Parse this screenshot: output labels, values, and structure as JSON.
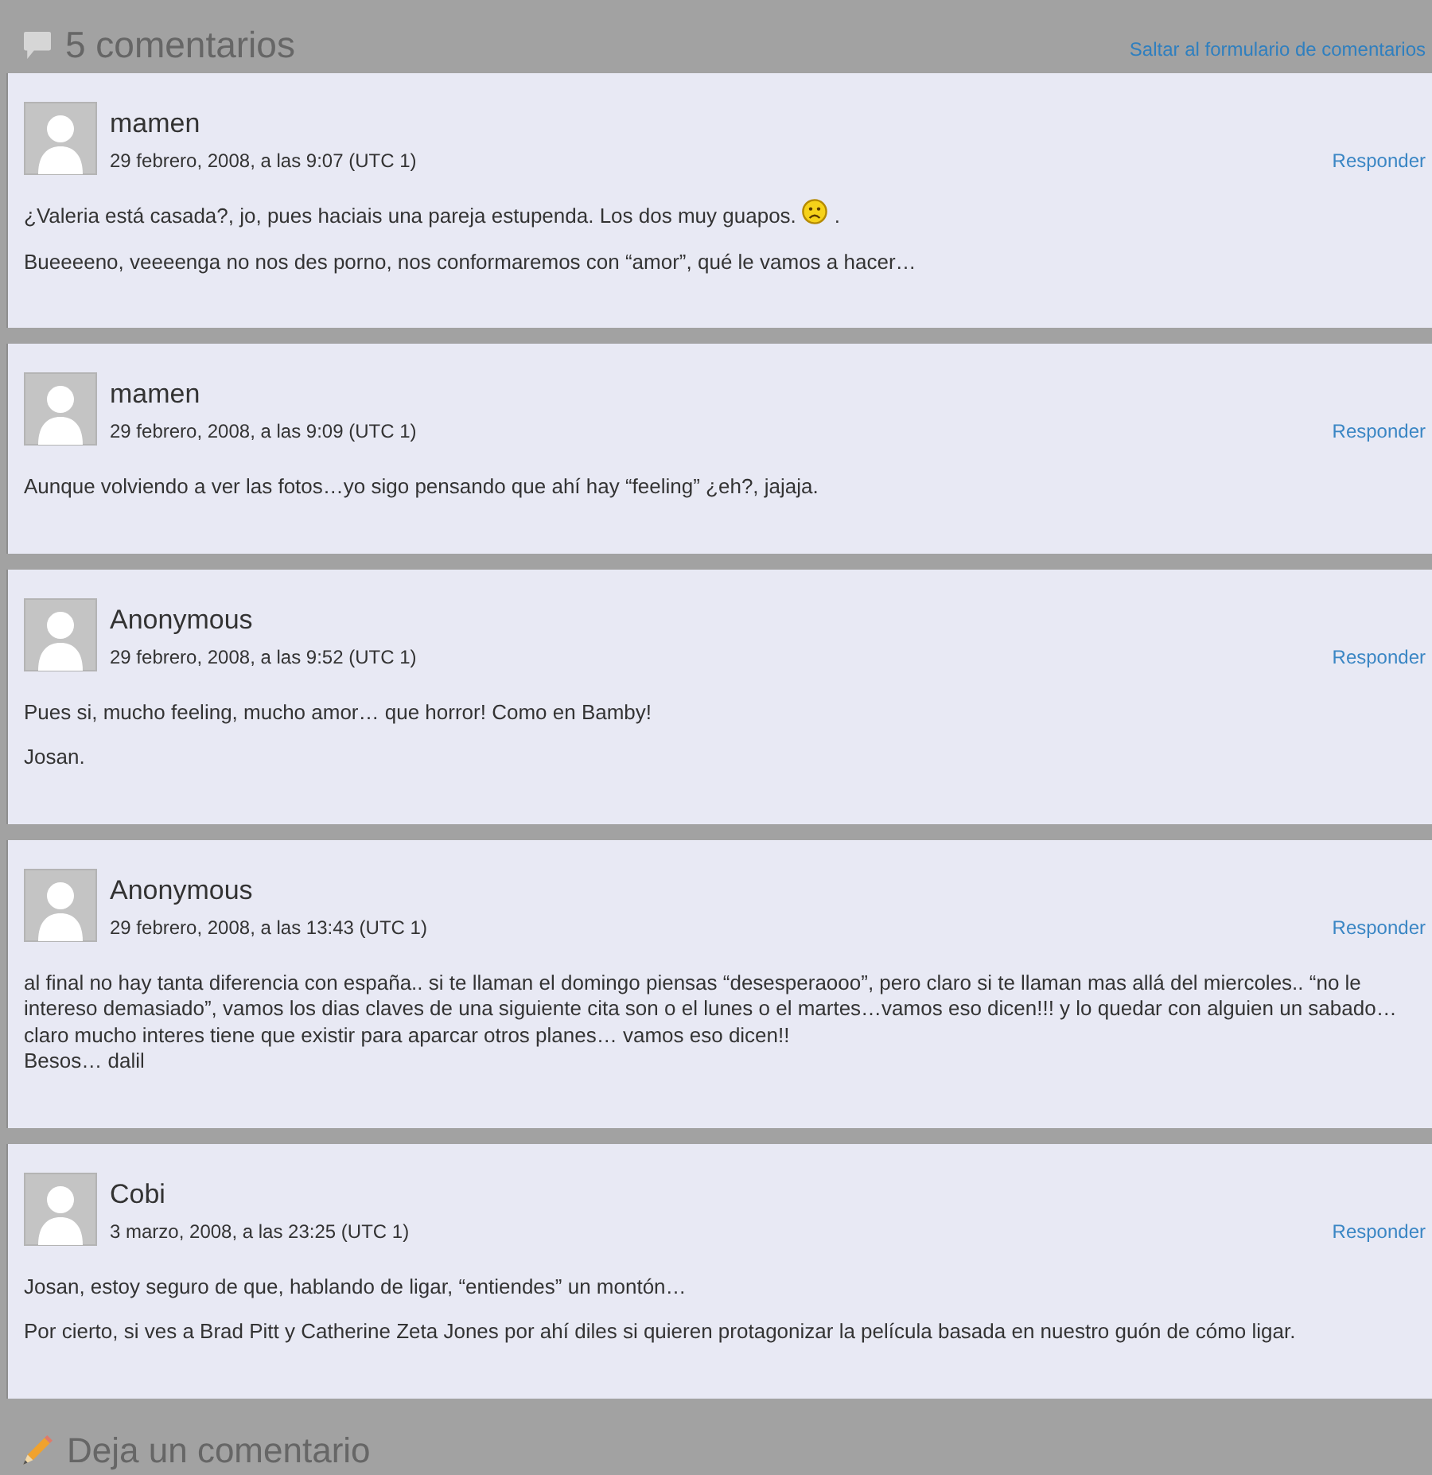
{
  "header": {
    "title": "5 comentarios",
    "skip_link": "Saltar al formulario de comentarios"
  },
  "comments": [
    {
      "author": "mamen",
      "date": "29 febrero, 2008, a las 9:07 (UTC 1)",
      "reply": "Responder",
      "paragraphs": [
        {
          "text": "¿Valeria está casada?, jo, pues haciais una pareja estupenda. Los dos muy guapos.",
          "emoticon": true,
          "tail": "."
        },
        {
          "text": "Bueeeeno, veeeenga no nos des porno, nos conformaremos con “amor”, qué le vamos a hacer…"
        }
      ]
    },
    {
      "author": "mamen",
      "date": "29 febrero, 2008, a las 9:09 (UTC 1)",
      "reply": "Responder",
      "paragraphs": [
        {
          "text": "Aunque volviendo a ver las fotos…yo sigo pensando que ahí hay “feeling” ¿eh?, jajaja."
        }
      ]
    },
    {
      "author": "Anonymous",
      "date": "29 febrero, 2008, a las 9:52 (UTC 1)",
      "reply": "Responder",
      "paragraphs": [
        {
          "text": "Pues si, mucho feeling, mucho amor… que horror! Como en Bamby!"
        },
        {
          "text": "Josan."
        }
      ]
    },
    {
      "author": "Anonymous",
      "date": "29 febrero, 2008, a las 13:43 (UTC 1)",
      "reply": "Responder",
      "paragraphs": [
        {
          "text": "al final no hay tanta diferencia con españa.. si te llaman el domingo piensas “desesperaooo”, pero claro si te llaman mas allá del miercoles.. “no le intereso demasiado”, vamos los dias claves de una siguiente cita son o el lunes o el martes…vamos eso dicen!!! y lo quedar con alguien un sabado… claro mucho interes tiene que existir para aparcar otros planes… vamos eso dicen!!\nBesos… dalil"
        }
      ]
    },
    {
      "author": "Cobi",
      "date": "3 marzo, 2008, a las 23:25 (UTC 1)",
      "reply": "Responder",
      "paragraphs": [
        {
          "text": "Josan, estoy seguro de que, hablando de ligar, “entiendes” un montón…"
        },
        {
          "text": "Por cierto, si ves a Brad Pitt y Catherine Zeta Jones por ahí diles si quieren protagonizar la película basada en nuestro guón de cómo ligar."
        }
      ]
    }
  ],
  "footer": {
    "title": "Deja un comentario"
  }
}
